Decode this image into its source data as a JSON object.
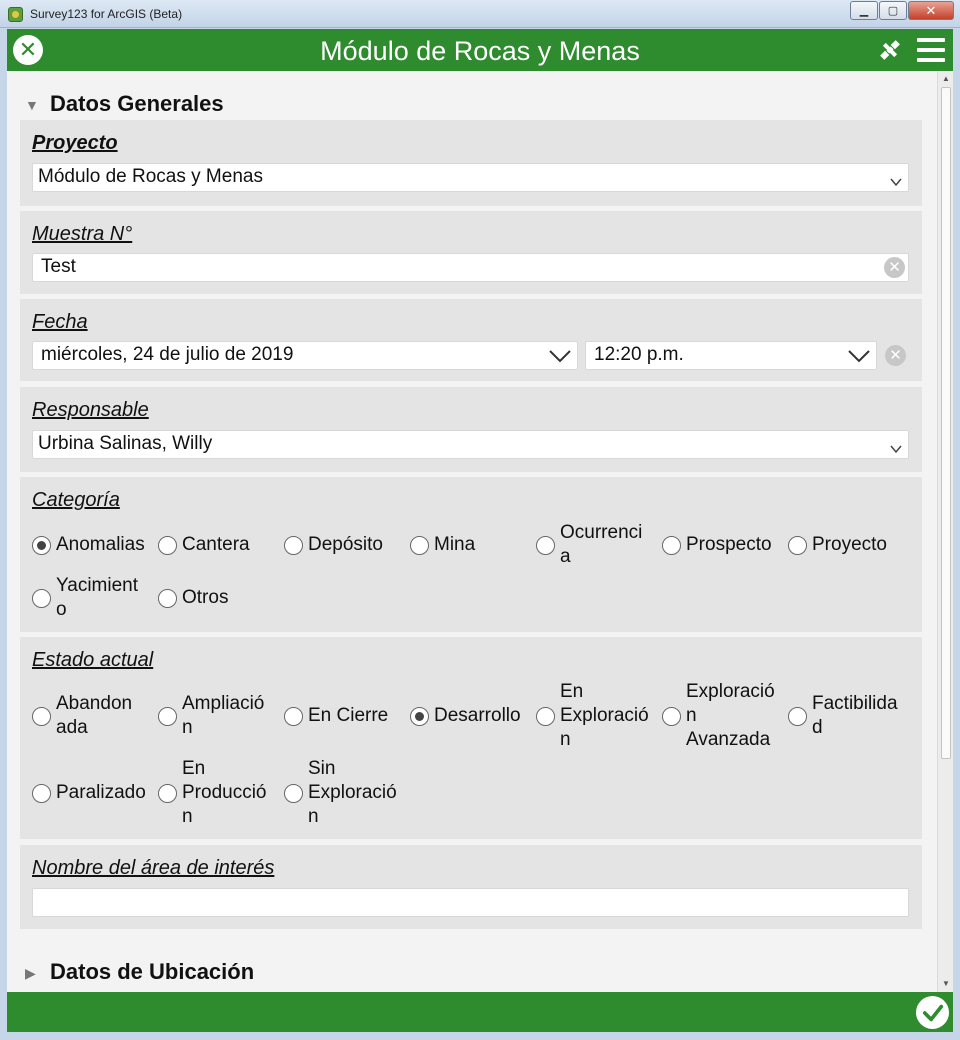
{
  "window": {
    "title": "Survey123 for ArcGIS (Beta)",
    "minimize": "▁",
    "maximize": "▢",
    "close": "✕"
  },
  "header": {
    "title": "Módulo de Rocas y Menas"
  },
  "groups": {
    "general": {
      "title": "Datos Generales",
      "arrow": "▼"
    },
    "location": {
      "title": "Datos de Ubicación",
      "arrow": "▶"
    }
  },
  "proyecto": {
    "label": "Proyecto",
    "value": "Módulo de Rocas y Menas"
  },
  "muestra": {
    "label": "Muestra N°",
    "value": "Test"
  },
  "fecha": {
    "label": "Fecha",
    "date": "miércoles, 24 de julio de 2019",
    "time": "12:20 p.m."
  },
  "responsable": {
    "label": "Responsable",
    "value": "Urbina Salinas, Willy"
  },
  "categoria": {
    "label": "Categoría",
    "options": [
      "Anomalias",
      "Cantera",
      "Depósito",
      "Mina",
      "Ocurrenci\na",
      "Prospecto",
      "Proyecto",
      "Yacimient\no",
      "Otros"
    ],
    "selected": "Anomalias"
  },
  "estado": {
    "label": "Estado actual",
    "options": [
      "Abandon\nada",
      "Ampliació\nn",
      "En Cierre",
      "Desarrollo",
      "En\nExploració\nn",
      "Exploració\nn\nAvanzada",
      "Factibilida\nd",
      "Paralizado",
      "En\nProducció\nn",
      "Sin\nExploració\nn"
    ],
    "selected": "Desarrollo"
  },
  "area": {
    "label": "Nombre del área de interés",
    "value": ""
  },
  "colors": {
    "brand_green": "#2e8b2e",
    "panel_gray": "#e4e4e4"
  }
}
